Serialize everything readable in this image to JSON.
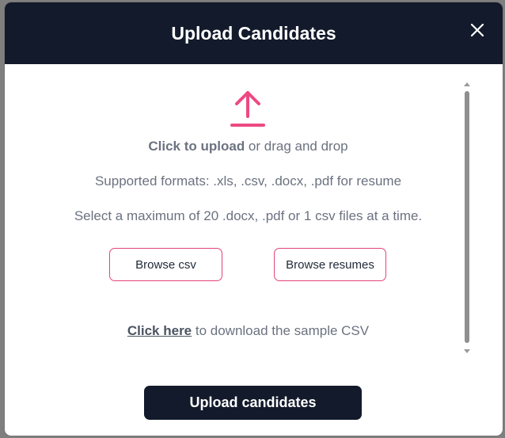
{
  "modal": {
    "title": "Upload Candidates",
    "close_icon": "close-icon"
  },
  "upload": {
    "icon": "upload-arrow-icon",
    "click_to_upload": "Click to upload",
    "drag_drop": " or drag and drop",
    "supported_formats": "Supported formats: .xls, .csv, .docx, .pdf for resume",
    "max_files": "Select a maximum of 20 .docx, .pdf or 1 csv files at a time."
  },
  "buttons": {
    "browse_csv": "Browse csv",
    "browse_resumes": "Browse resumes",
    "upload_candidates": "Upload candidates"
  },
  "sample": {
    "link_text": "Click here",
    "rest_text": " to download the sample CSV"
  },
  "colors": {
    "header_bg": "#121a2b",
    "accent_pink": "#e3447a",
    "text_gray": "#6b7280"
  }
}
